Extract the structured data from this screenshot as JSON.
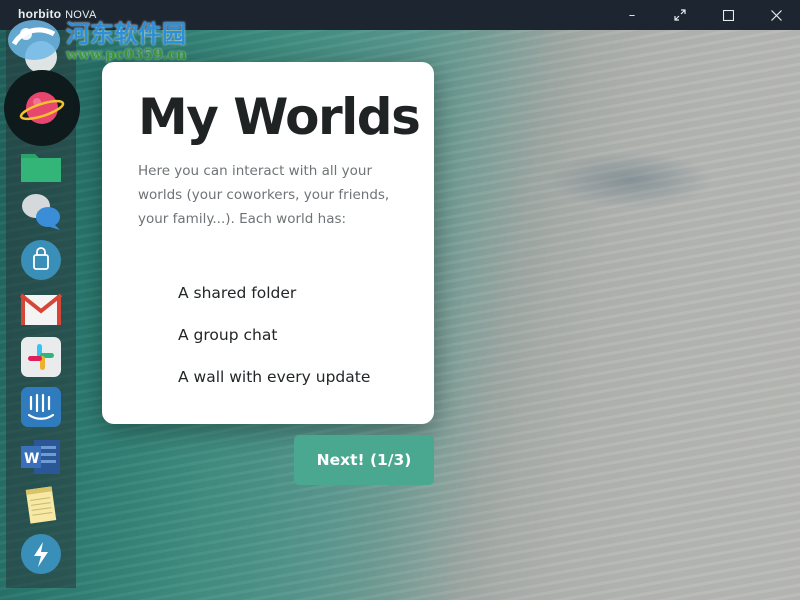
{
  "titlebar": {
    "brand_name": "horbito",
    "brand_product": "NOVA",
    "controls": [
      "minimize",
      "fullscreen",
      "maximize",
      "close"
    ]
  },
  "watermark": {
    "chinese_text": "河东软件园",
    "url": "www.pc0359.cn"
  },
  "dock": {
    "items": [
      {
        "name": "worlds",
        "icon": "planet-icon"
      },
      {
        "name": "files",
        "icon": "folder-icon"
      },
      {
        "name": "chat",
        "icon": "chat-bubbles-icon"
      },
      {
        "name": "store",
        "icon": "shopping-bag-icon"
      },
      {
        "name": "gmail",
        "icon": "gmail-icon"
      },
      {
        "name": "slack",
        "icon": "slack-icon"
      },
      {
        "name": "intercom",
        "icon": "intercom-icon"
      },
      {
        "name": "word",
        "icon": "word-icon"
      },
      {
        "name": "notes",
        "icon": "notepad-icon"
      },
      {
        "name": "lightning",
        "icon": "lightning-icon"
      }
    ]
  },
  "card": {
    "title": "My Worlds",
    "description": "Here you can interact with all your worlds (your coworkers, your friends, your family...). Each world has:",
    "features": [
      "A shared folder",
      "A group chat",
      "A wall with every update"
    ]
  },
  "next_button": {
    "label": "Next! (1/3)"
  },
  "colors": {
    "accent": "#4aa890",
    "titlebar": "#1d2630",
    "card_bg": "#ffffff"
  }
}
